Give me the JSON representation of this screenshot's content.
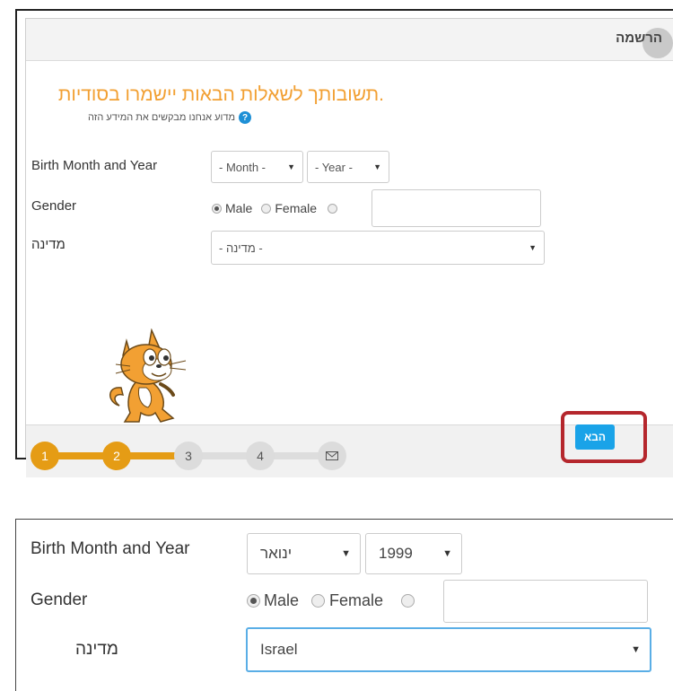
{
  "dialog": {
    "title": "הרשמה",
    "heading": "תשובותך לשאלות הבאות יישמרו בסודיות.",
    "why_link": "מדוע אנחנו מבקשים את המידע הזה",
    "help_glyph": "?"
  },
  "form_top": {
    "birth_label": "Birth Month and Year",
    "month_value": "- Month -",
    "year_value": "- Year -",
    "gender_label": "Gender",
    "male_label": "Male",
    "female_label": "Female",
    "selected_gender": "Male",
    "country_label": "מדינה",
    "country_value": "- מדינה -"
  },
  "progress": {
    "steps": [
      "1",
      "2",
      "3",
      "4"
    ],
    "current_step": 2,
    "last_step_icon": "envelope-icon"
  },
  "footer": {
    "next_label": "הבא"
  },
  "form_bottom": {
    "birth_label": "Birth Month and Year",
    "month_value": "ינואר",
    "year_value": "1999",
    "gender_label": "Gender",
    "male_label": "Male",
    "female_label": "Female",
    "selected_gender": "Male",
    "country_label": "מדינה",
    "country_value": "Israel"
  },
  "colors": {
    "accent_orange": "#e59c15",
    "heading_orange": "#f2a033",
    "primary_blue": "#1aa3e8",
    "highlight_red": "#b5272d"
  }
}
